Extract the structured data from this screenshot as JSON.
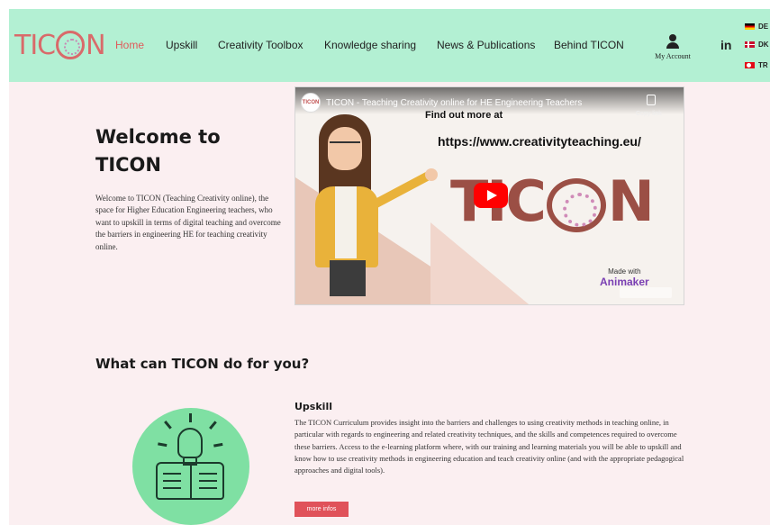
{
  "header": {
    "logo_left": "TIC",
    "logo_right": "N",
    "nav": [
      {
        "label": "Home",
        "active": true
      },
      {
        "label": "Upskill",
        "active": false
      },
      {
        "label": "Creativity Toolbox",
        "active": false
      },
      {
        "label": "Knowledge sharing",
        "active": false
      },
      {
        "label": "News & Publications",
        "active": false
      },
      {
        "label": "Behind TICON",
        "active": false
      }
    ],
    "account_label": "My Account",
    "linkedin_label": "in",
    "languages": [
      {
        "code": "DE",
        "flag": "germany-flag"
      },
      {
        "code": "DK",
        "flag": "denmark-flag"
      },
      {
        "code": "TR",
        "flag": "turkey-flag"
      }
    ]
  },
  "welcome": {
    "title": "Welcome to TICON",
    "text": "Welcome to TICON (Teaching Creativity online), the space for Higher Education Engineering teachers, who want to upskill in terms of digital teaching and overcome the barriers in engineering HE for teaching creativity online."
  },
  "video": {
    "channel": "TICON",
    "title": "TICON - Teaching Creativity online for HE Engineering Teachers",
    "copy_label": "Copy link",
    "find_out": "Find out more at",
    "url": "https://www.creativityteaching.eu/",
    "logo_left": "TIC",
    "logo_right": "N",
    "made_with": "Made with",
    "animaker": "Animaker"
  },
  "section": {
    "title": "What can TICON do for you?"
  },
  "upskill": {
    "heading": "Upskill",
    "text": "The TICON Curriculum provides insight into the barriers and challenges to using creativity methods in teaching online, in particular with regards to engineering and related creativity techniques, and the skills and competences required to overcome these barriers. Access to the e-learning platform where, with our training and learning materials you will be able to upskill and know how to use creativity methods in engineering education and teach creativity online (and with the appropriate pedagogical approaches and digital tools).",
    "button_label": "more infos"
  },
  "colors": {
    "header_bg": "#b3f0d3",
    "page_bg": "#fbeff1",
    "accent": "#e05a5a",
    "logo": "#d96a6a",
    "button": "#e0525a",
    "icon_circle": "#7fe0a3"
  }
}
